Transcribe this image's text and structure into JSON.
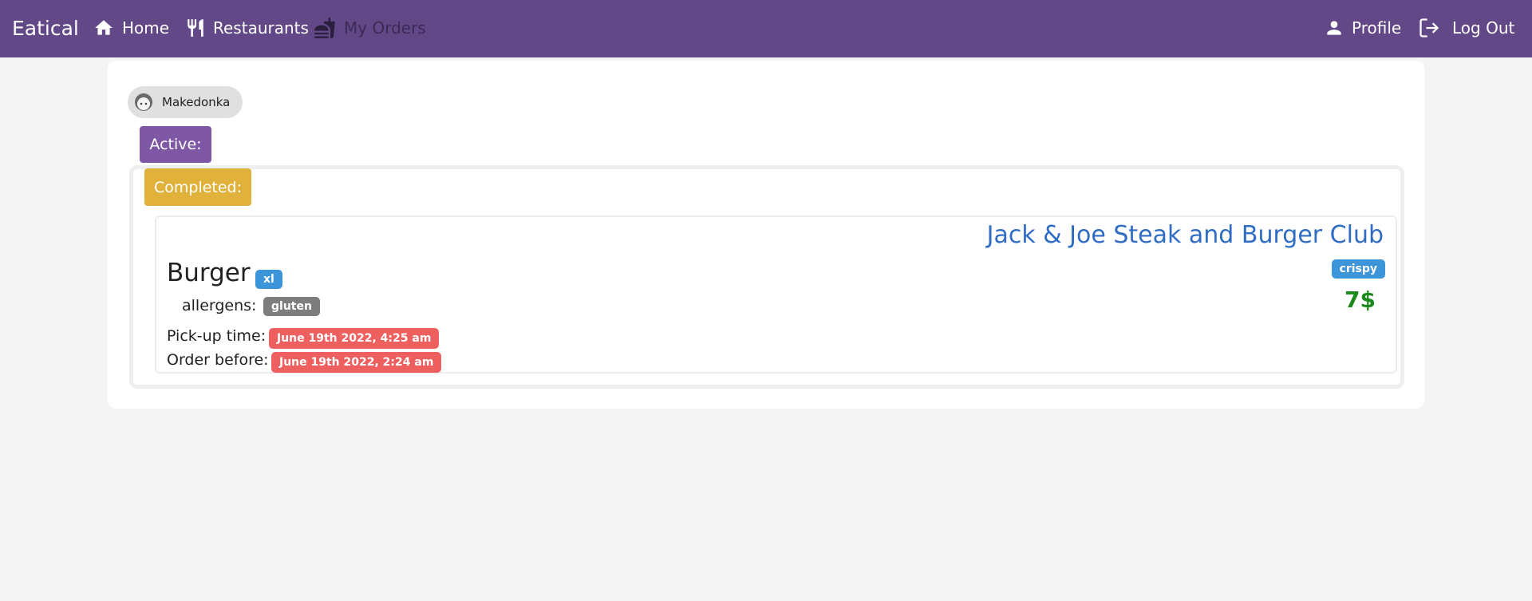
{
  "navbar": {
    "brand": "Eatical",
    "home": "Home",
    "restaurants": "Restaurants",
    "my_orders": "My Orders",
    "profile": "Profile",
    "logout": "Log Out"
  },
  "user": {
    "name": "Makedonka"
  },
  "sections": {
    "active": "Active:",
    "completed": "Completed:"
  },
  "order": {
    "restaurant": "Jack & Joe Steak and Burger Club",
    "dish": "Burger",
    "size": "xl",
    "tag": "crispy",
    "allergens_label": "allergens:",
    "allergen": "gluten",
    "price": "7$",
    "pickup_label": "Pick-up time:",
    "pickup_time": "June 19th 2022, 4:25 am",
    "order_before_label": "Order before:",
    "order_before_time": "June 19th 2022, 2:24 am"
  },
  "colors": {
    "navbar": "#634888",
    "active": "#7e58a5",
    "completed": "#e0b23b",
    "restaurant_link": "#2f6cc4",
    "info_badge": "#3d95d9",
    "date_badge": "#ee6060",
    "price": "#1b8a1b"
  },
  "icons": {
    "home": "home-icon",
    "restaurants": "fork-knife-icon",
    "my_orders": "food-cart-icon",
    "profile": "person-icon",
    "logout": "logout-icon",
    "avatar": "user-face-icon"
  }
}
